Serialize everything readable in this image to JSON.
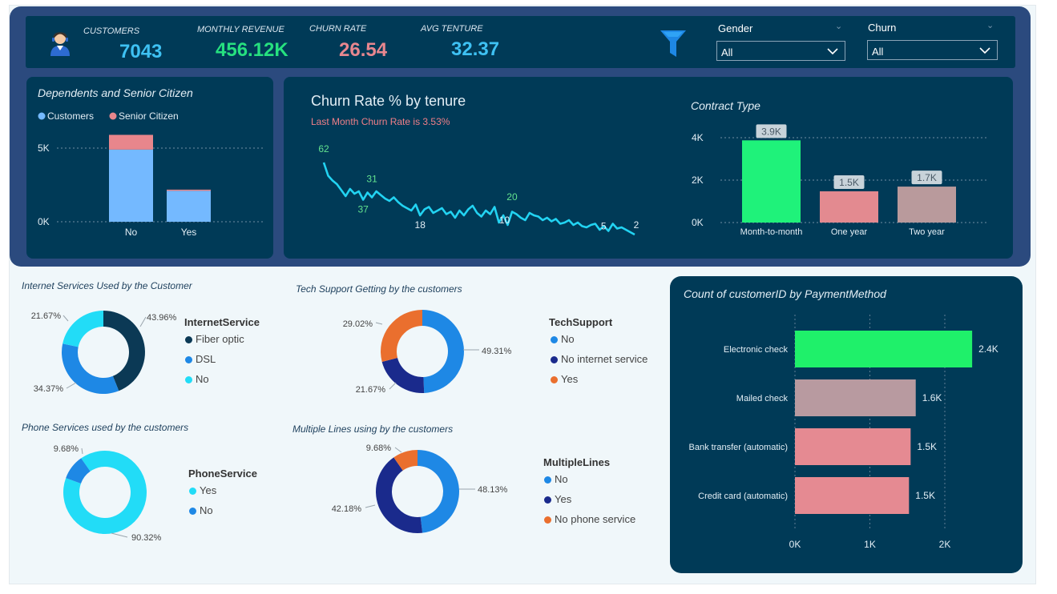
{
  "kpis": {
    "customers": {
      "label": "CUSTOMERS",
      "value": "7043",
      "color": "#3ec1f3"
    },
    "revenue": {
      "label": "MONTHLY REVENUE",
      "value": "456.12K",
      "color": "#26e07f"
    },
    "churn": {
      "label": "CHURN RATE",
      "value": "26.54",
      "color": "#e8878f"
    },
    "tenure": {
      "label": "AVG TENTURE",
      "value": "32.37",
      "color": "#3ec1f3"
    }
  },
  "icons": {
    "avatar": "support-agent-icon",
    "filter": "funnel-icon",
    "chevron": "chevron-down-icon"
  },
  "slicers": {
    "gender": {
      "title": "Gender",
      "value": "All"
    },
    "churn": {
      "title": "Churn",
      "value": "All"
    }
  },
  "dependents": {
    "title": "Dependents and Senior Citizen",
    "legend": [
      "Customers",
      "Senior Citizen"
    ],
    "colors": [
      "#74b9ff",
      "#e8868c"
    ],
    "ticks": [
      "5K",
      "0K"
    ],
    "chart_data": {
      "type": "bar",
      "stacked": true,
      "categories": [
        "No",
        "Yes"
      ],
      "series": [
        {
          "name": "Customers",
          "values": [
            4900,
            2100
          ]
        },
        {
          "name": "Senior Citizen",
          "values": [
            1000,
            80
          ]
        }
      ],
      "ylim": [
        0,
        6000
      ],
      "grid": true,
      "legend": "top-left"
    }
  },
  "tenure": {
    "title": "Churn Rate % by tenure",
    "subtitle": "Last Month Churn Rate is 3.53%",
    "labels": [
      "62",
      "37",
      "31",
      "18",
      "10",
      "20",
      "5",
      "2"
    ],
    "chart_data": {
      "type": "line",
      "x": [
        1,
        2,
        3,
        4,
        5,
        6,
        7,
        8,
        9,
        10,
        11,
        12,
        13,
        14,
        15,
        16,
        17,
        18,
        19,
        20,
        21,
        22,
        23,
        24,
        25,
        26,
        27,
        28,
        29,
        30,
        31,
        32,
        33,
        34,
        35,
        36,
        37,
        38,
        39,
        40,
        41,
        42,
        43,
        44,
        45,
        46,
        47,
        48,
        49,
        50,
        51,
        52,
        53,
        54,
        55,
        56,
        57,
        58,
        59,
        60,
        61,
        62,
        63,
        64,
        65,
        66,
        67,
        68,
        69,
        70,
        71,
        72
      ],
      "y": [
        62,
        51,
        47,
        44,
        39,
        34,
        40,
        36,
        38,
        31,
        37,
        33,
        38,
        35,
        32,
        30,
        33,
        29,
        26,
        24,
        22,
        27,
        18,
        23,
        25,
        20,
        22,
        24,
        19,
        21,
        16,
        22,
        18,
        23,
        26,
        20,
        17,
        22,
        19,
        25,
        12,
        18,
        10,
        21,
        19,
        16,
        14,
        20,
        18,
        17,
        14,
        16,
        13,
        15,
        11,
        12,
        14,
        10,
        12,
        9,
        8,
        10,
        11,
        6,
        9,
        5,
        11,
        7,
        8,
        6,
        4,
        2
      ],
      "xlabel": "",
      "ylabel": ""
    }
  },
  "contract": {
    "title": "Contract Type",
    "ticks": [
      "4K",
      "2K",
      "0K"
    ],
    "value_labels": [
      "3.9K",
      "1.5K",
      "1.7K"
    ],
    "colors": [
      "#1ff27a",
      "#e38a90",
      "#b99a9c"
    ],
    "chart_data": {
      "type": "bar",
      "categories": [
        "Month-to-month",
        "One year",
        "Two year"
      ],
      "values": [
        3875,
        1473,
        1695
      ],
      "ylim": [
        0,
        4000
      ],
      "grid": true
    }
  },
  "internet": {
    "title": "Internet Services Used by the Customer",
    "legend_title": "InternetService",
    "pct_labels": [
      "43.96%",
      "34.37%",
      "21.67%"
    ],
    "colors": [
      "#0b3955",
      "#1e88e5",
      "#22dcf7"
    ],
    "chart_data": {
      "type": "pie",
      "donut": true,
      "categories": [
        "Fiber optic",
        "DSL",
        "No"
      ],
      "values": [
        43.96,
        34.37,
        21.67
      ]
    }
  },
  "techsupport": {
    "title": "Tech Support Getting by the customers",
    "legend_title": "TechSupport",
    "pct_labels": [
      "49.31%",
      "21.67%",
      "29.02%"
    ],
    "colors": [
      "#1e88e5",
      "#1a2a8c",
      "#ea6f2e"
    ],
    "chart_data": {
      "type": "pie",
      "donut": true,
      "categories": [
        "No",
        "No internet service",
        "Yes"
      ],
      "values": [
        49.31,
        21.67,
        29.02
      ]
    }
  },
  "phone": {
    "title": "Phone Services used by the customers",
    "legend_title": "PhoneService",
    "pct_labels": [
      "90.32%",
      "9.68%"
    ],
    "colors": [
      "#22dcf7",
      "#1e88e5"
    ],
    "chart_data": {
      "type": "pie",
      "donut": true,
      "categories": [
        "Yes",
        "No"
      ],
      "values": [
        90.32,
        9.68
      ]
    }
  },
  "multilines": {
    "title": "Multiple Lines using by the customers",
    "legend_title": "MultipleLines",
    "pct_labels": [
      "48.13%",
      "42.18%",
      "9.68%"
    ],
    "colors": [
      "#1e88e5",
      "#1a2a8c",
      "#ea6f2e"
    ],
    "chart_data": {
      "type": "pie",
      "donut": true,
      "categories": [
        "No",
        "Yes",
        "No phone service"
      ],
      "values": [
        48.13,
        42.18,
        9.68
      ]
    }
  },
  "payment": {
    "title": "Count of customerID by PaymentMethod",
    "ticks": [
      "0K",
      "1K",
      "2K"
    ],
    "value_labels": [
      "2.4K",
      "1.6K",
      "1.5K",
      "1.5K"
    ],
    "colors": [
      "#1ff06a",
      "#b89aa0",
      "#e58a92",
      "#e58a92"
    ],
    "chart_data": {
      "type": "bar",
      "orientation": "horizontal",
      "categories": [
        "Electronic check",
        "Mailed check",
        "Bank transfer (automatic)",
        "Credit card (automatic)"
      ],
      "values": [
        2365,
        1612,
        1544,
        1522
      ],
      "xlim": [
        0,
        2500
      ],
      "grid": true
    }
  }
}
